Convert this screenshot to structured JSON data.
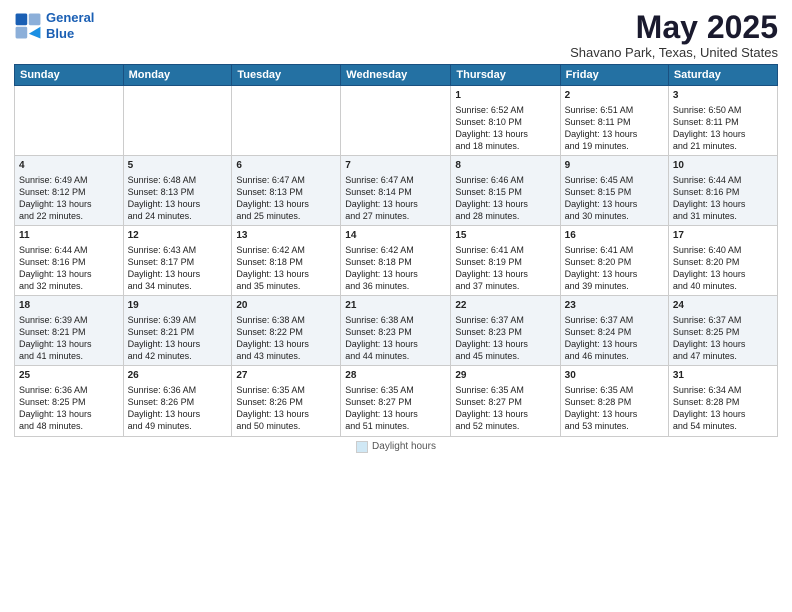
{
  "header": {
    "logo_line1": "General",
    "logo_line2": "Blue",
    "month": "May 2025",
    "location": "Shavano Park, Texas, United States"
  },
  "weekdays": [
    "Sunday",
    "Monday",
    "Tuesday",
    "Wednesday",
    "Thursday",
    "Friday",
    "Saturday"
  ],
  "rows": [
    [
      {
        "day": "",
        "info": ""
      },
      {
        "day": "",
        "info": ""
      },
      {
        "day": "",
        "info": ""
      },
      {
        "day": "",
        "info": ""
      },
      {
        "day": "1",
        "info": "Sunrise: 6:52 AM\nSunset: 8:10 PM\nDaylight: 13 hours\nand 18 minutes."
      },
      {
        "day": "2",
        "info": "Sunrise: 6:51 AM\nSunset: 8:11 PM\nDaylight: 13 hours\nand 19 minutes."
      },
      {
        "day": "3",
        "info": "Sunrise: 6:50 AM\nSunset: 8:11 PM\nDaylight: 13 hours\nand 21 minutes."
      }
    ],
    [
      {
        "day": "4",
        "info": "Sunrise: 6:49 AM\nSunset: 8:12 PM\nDaylight: 13 hours\nand 22 minutes."
      },
      {
        "day": "5",
        "info": "Sunrise: 6:48 AM\nSunset: 8:13 PM\nDaylight: 13 hours\nand 24 minutes."
      },
      {
        "day": "6",
        "info": "Sunrise: 6:47 AM\nSunset: 8:13 PM\nDaylight: 13 hours\nand 25 minutes."
      },
      {
        "day": "7",
        "info": "Sunrise: 6:47 AM\nSunset: 8:14 PM\nDaylight: 13 hours\nand 27 minutes."
      },
      {
        "day": "8",
        "info": "Sunrise: 6:46 AM\nSunset: 8:15 PM\nDaylight: 13 hours\nand 28 minutes."
      },
      {
        "day": "9",
        "info": "Sunrise: 6:45 AM\nSunset: 8:15 PM\nDaylight: 13 hours\nand 30 minutes."
      },
      {
        "day": "10",
        "info": "Sunrise: 6:44 AM\nSunset: 8:16 PM\nDaylight: 13 hours\nand 31 minutes."
      }
    ],
    [
      {
        "day": "11",
        "info": "Sunrise: 6:44 AM\nSunset: 8:16 PM\nDaylight: 13 hours\nand 32 minutes."
      },
      {
        "day": "12",
        "info": "Sunrise: 6:43 AM\nSunset: 8:17 PM\nDaylight: 13 hours\nand 34 minutes."
      },
      {
        "day": "13",
        "info": "Sunrise: 6:42 AM\nSunset: 8:18 PM\nDaylight: 13 hours\nand 35 minutes."
      },
      {
        "day": "14",
        "info": "Sunrise: 6:42 AM\nSunset: 8:18 PM\nDaylight: 13 hours\nand 36 minutes."
      },
      {
        "day": "15",
        "info": "Sunrise: 6:41 AM\nSunset: 8:19 PM\nDaylight: 13 hours\nand 37 minutes."
      },
      {
        "day": "16",
        "info": "Sunrise: 6:41 AM\nSunset: 8:20 PM\nDaylight: 13 hours\nand 39 minutes."
      },
      {
        "day": "17",
        "info": "Sunrise: 6:40 AM\nSunset: 8:20 PM\nDaylight: 13 hours\nand 40 minutes."
      }
    ],
    [
      {
        "day": "18",
        "info": "Sunrise: 6:39 AM\nSunset: 8:21 PM\nDaylight: 13 hours\nand 41 minutes."
      },
      {
        "day": "19",
        "info": "Sunrise: 6:39 AM\nSunset: 8:21 PM\nDaylight: 13 hours\nand 42 minutes."
      },
      {
        "day": "20",
        "info": "Sunrise: 6:38 AM\nSunset: 8:22 PM\nDaylight: 13 hours\nand 43 minutes."
      },
      {
        "day": "21",
        "info": "Sunrise: 6:38 AM\nSunset: 8:23 PM\nDaylight: 13 hours\nand 44 minutes."
      },
      {
        "day": "22",
        "info": "Sunrise: 6:37 AM\nSunset: 8:23 PM\nDaylight: 13 hours\nand 45 minutes."
      },
      {
        "day": "23",
        "info": "Sunrise: 6:37 AM\nSunset: 8:24 PM\nDaylight: 13 hours\nand 46 minutes."
      },
      {
        "day": "24",
        "info": "Sunrise: 6:37 AM\nSunset: 8:25 PM\nDaylight: 13 hours\nand 47 minutes."
      }
    ],
    [
      {
        "day": "25",
        "info": "Sunrise: 6:36 AM\nSunset: 8:25 PM\nDaylight: 13 hours\nand 48 minutes."
      },
      {
        "day": "26",
        "info": "Sunrise: 6:36 AM\nSunset: 8:26 PM\nDaylight: 13 hours\nand 49 minutes."
      },
      {
        "day": "27",
        "info": "Sunrise: 6:35 AM\nSunset: 8:26 PM\nDaylight: 13 hours\nand 50 minutes."
      },
      {
        "day": "28",
        "info": "Sunrise: 6:35 AM\nSunset: 8:27 PM\nDaylight: 13 hours\nand 51 minutes."
      },
      {
        "day": "29",
        "info": "Sunrise: 6:35 AM\nSunset: 8:27 PM\nDaylight: 13 hours\nand 52 minutes."
      },
      {
        "day": "30",
        "info": "Sunrise: 6:35 AM\nSunset: 8:28 PM\nDaylight: 13 hours\nand 53 minutes."
      },
      {
        "day": "31",
        "info": "Sunrise: 6:34 AM\nSunset: 8:28 PM\nDaylight: 13 hours\nand 54 minutes."
      }
    ]
  ],
  "footer": {
    "legend_label": "Daylight hours"
  }
}
